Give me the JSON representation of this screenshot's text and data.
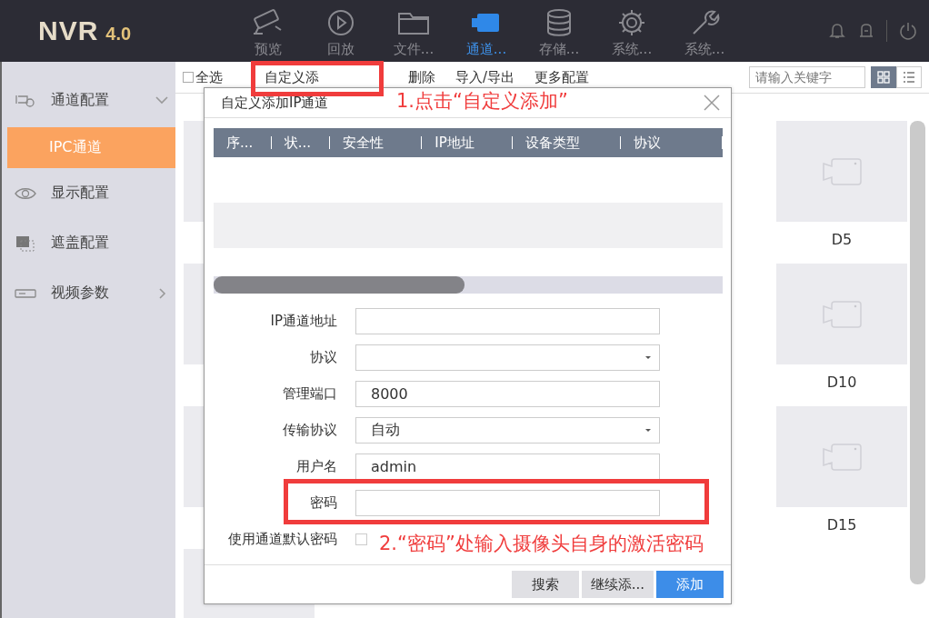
{
  "header": {
    "logo": "NVR",
    "version": "4.0",
    "nav": [
      {
        "label": "预览",
        "selected": false
      },
      {
        "label": "回放",
        "selected": false
      },
      {
        "label": "文件...",
        "selected": false
      },
      {
        "label": "通道...",
        "selected": true
      },
      {
        "label": "存储...",
        "selected": false
      },
      {
        "label": "系统...",
        "selected": false
      },
      {
        "label": "系统...",
        "selected": false
      }
    ]
  },
  "sidebar": {
    "items": [
      {
        "label": "通道配置",
        "expanded": true,
        "children": [
          {
            "label": "IPC通道",
            "selected": true
          }
        ]
      },
      {
        "label": "显示配置",
        "selected": false
      },
      {
        "label": "遮盖配置",
        "selected": false
      },
      {
        "label": "视频参数",
        "expanded": false
      }
    ]
  },
  "toolbar": {
    "select_all": {
      "label": "全选",
      "checked": false
    },
    "actions": [
      "自定义添",
      "删除",
      "导入/导出",
      "更多配置"
    ],
    "search": {
      "placeholder": "请输入关键字"
    },
    "views": [
      {
        "selected": true
      },
      {
        "selected": false
      }
    ]
  },
  "channels": [
    {
      "label": "D5"
    },
    {
      "label": "D10"
    },
    {
      "label": "D15"
    }
  ],
  "dialog": {
    "title": "自定义添加IP通道",
    "table": {
      "columns": [
        "序...",
        "状...",
        "安全性",
        "IP地址",
        "设备类型",
        "协议"
      ]
    },
    "fields": [
      {
        "label": "IP通道地址",
        "kind": "text"
      },
      {
        "label": "协议",
        "kind": "select"
      },
      {
        "label": "管理端口",
        "kind": "text",
        "value": "8000"
      },
      {
        "label": "传输协议",
        "kind": "select",
        "value": "自动"
      },
      {
        "label": "用户名",
        "kind": "text",
        "value": "admin"
      },
      {
        "label": "密码",
        "kind": "text"
      }
    ],
    "default_password": {
      "label": "使用通道默认密码",
      "checked": false
    },
    "buttons": [
      {
        "label": "搜索",
        "primary": false
      },
      {
        "label": "继续添...",
        "primary": false
      },
      {
        "label": "添加",
        "primary": true
      }
    ]
  },
  "annotations": [
    "1.点击“自定义添加”",
    "2.“密码”处输入摄像头自身的激活密码"
  ]
}
